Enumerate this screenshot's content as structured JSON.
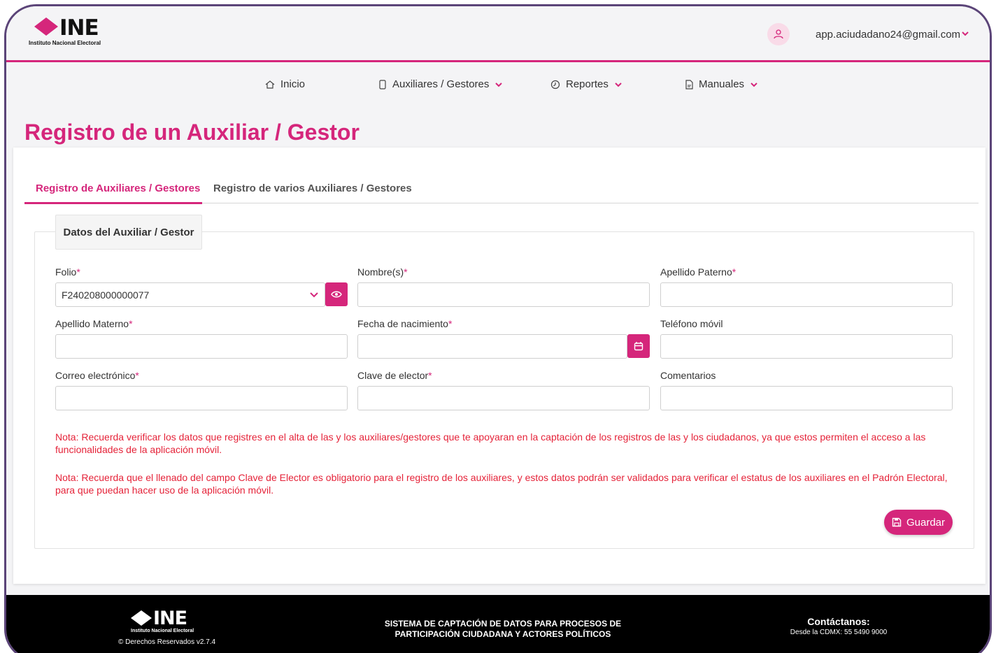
{
  "brand": {
    "name": "INE",
    "subtitle": "Instituto Nacional Electoral",
    "accent_color": "#d5267b",
    "logo_icon": "diamond-icon"
  },
  "user": {
    "email": "app.aciudadano24@gmail.com",
    "avatar_icon": "user-icon",
    "menu_icon": "chevron-down-icon"
  },
  "nav": {
    "items": [
      {
        "label": "Inicio",
        "icon": "home-icon"
      },
      {
        "label": "Auxiliares / Gestores",
        "icon": "phone-icon",
        "dropdown": true
      },
      {
        "label": "Reportes",
        "icon": "clock-icon",
        "dropdown": true
      },
      {
        "label": "Manuales",
        "icon": "document-icon",
        "dropdown": true
      }
    ]
  },
  "page": {
    "title": "Registro de un Auxiliar / Gestor"
  },
  "tabs": [
    {
      "label": "Registro de Auxiliares / Gestores",
      "active": true
    },
    {
      "label": "Registro de varios Auxiliares / Gestores",
      "active": false
    }
  ],
  "form": {
    "section_title": "Datos del Auxiliar / Gestor",
    "fields": {
      "folio": {
        "label": "Folio",
        "required": "*",
        "value": "F240208000000077"
      },
      "nombre": {
        "label": "Nombre(s)",
        "required": "*",
        "value": ""
      },
      "apellido_paterno": {
        "label": "Apellido Paterno",
        "required": "*",
        "value": ""
      },
      "apellido_materno": {
        "label": "Apellido Materno",
        "required": "*",
        "value": ""
      },
      "fecha_nacimiento": {
        "label": "Fecha de nacimiento",
        "required": "*",
        "value": ""
      },
      "telefono": {
        "label": "Teléfono móvil",
        "value": ""
      },
      "correo": {
        "label": "Correo electrónico",
        "required": "*",
        "value": ""
      },
      "clave_elector": {
        "label": "Clave de elector",
        "required": "*",
        "value": ""
      },
      "comentarios": {
        "label": "Comentarios",
        "value": ""
      }
    },
    "notes": [
      "Nota: Recuerda verificar los datos que registres en el alta de las y los auxiliares/gestores que te apoyaran en la captación de los registros de las y los ciudadanos, ya que estos permiten el acceso a las funcionalidades de la aplicación móvil.",
      "Nota: Recuerda que el llenado del campo Clave de Elector es obligatorio para el registro de los auxiliares, y estos datos podrán ser validados para verificar el estatus de los auxiliares en el Padrón Electoral, para que puedan hacer uso de la aplicación móvil."
    ],
    "note_color": "#e52339",
    "save_label": "Guardar"
  },
  "footer": {
    "brand": "INE",
    "brand_subtitle": "Instituto Nacional Electoral",
    "rights": "© Derechos Reservados v2.7.4",
    "system_name_line1": "SISTEMA DE CAPTACIÓN DE DATOS PARA PROCESOS DE",
    "system_name_line2": "PARTICIPACIÓN CIUDADANA Y ACTORES POLÍTICOS",
    "contact_title": "Contáctanos:",
    "contact_phone": "Desde la CDMX: 55 5490 9000"
  }
}
